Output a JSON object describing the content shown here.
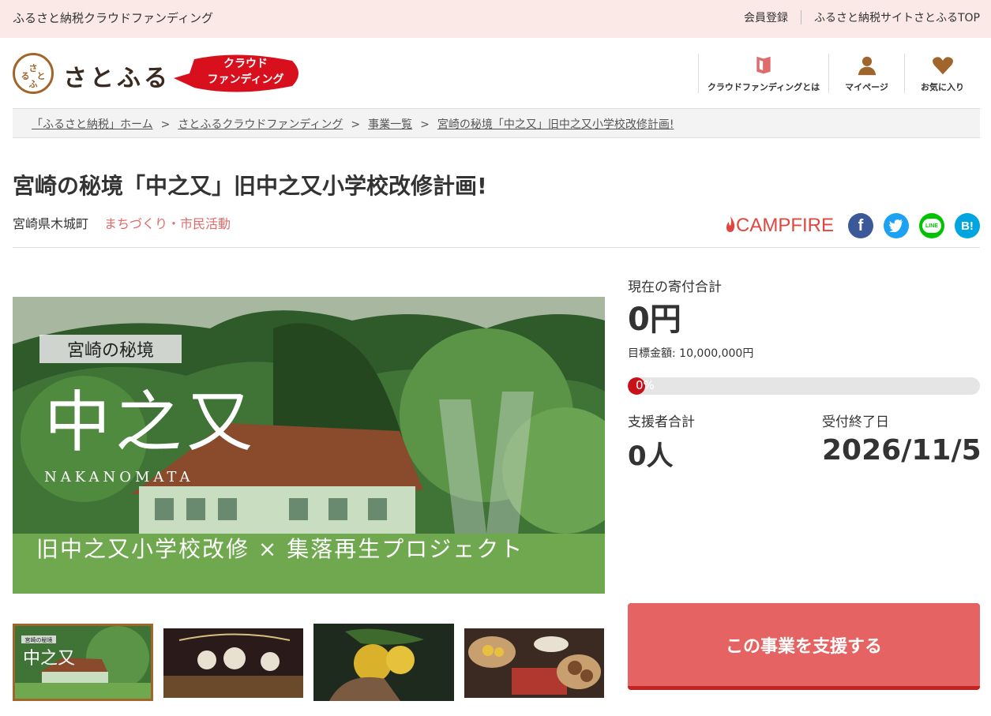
{
  "topbar": {
    "site_name": "ふるさと納税クラウドファンディング",
    "register": "会員登録",
    "main_site": "ふるさと納税サイトさとふるTOP"
  },
  "header": {
    "logo_mark": "さとふる",
    "logo_text": "さとふる",
    "badge_line1": "クラウド",
    "badge_line2": "ファンディング",
    "nav": [
      {
        "label": "クラウドファンディングとは",
        "icon": "book-icon"
      },
      {
        "label": "マイページ",
        "icon": "person-icon"
      },
      {
        "label": "お気に入り",
        "icon": "heart-icon"
      }
    ]
  },
  "breadcrumb": [
    "「ふるさと納税」ホーム",
    "さとふるクラウドファンディング",
    "事業一覧",
    "宮崎の秘境「中之又」旧中之又小学校改修計画!"
  ],
  "project": {
    "title": "宮崎の秘境「中之又」旧中之又小学校改修計画!",
    "location": "宮崎県木城町",
    "category": "まちづくり・市民活動",
    "partner": "CAMPFIRE"
  },
  "social": [
    {
      "name": "facebook",
      "glyph": "f",
      "color": "#3b5998"
    },
    {
      "name": "twitter",
      "glyph": "t",
      "color": "#1da1f2"
    },
    {
      "name": "line",
      "glyph": "LINE",
      "color": "#00c300"
    },
    {
      "name": "hatena",
      "glyph": "B!",
      "color": "#00a4de"
    }
  ],
  "image": {
    "small_caption": "宮崎の秘境",
    "big_caption": "中之又",
    "en_caption": "NAKANOMATA",
    "bottom_caption": "旧中之又小学校改修 × 集落再生プロジェクト"
  },
  "stats": {
    "total_label": "現在の寄付合計",
    "total_value": "0円",
    "goal_text": "目標金額: 10,000,000円",
    "progress_text": "0%",
    "progress_fraction": 0,
    "backers_label": "支援者合計",
    "backers_value": "0人",
    "end_label": "受付終了日",
    "end_value": "2026/11/5"
  },
  "cta": {
    "label": "この事業を支援する"
  },
  "colors": {
    "accent": "#e56363",
    "accent_dark": "#c22323",
    "brand_brown": "#a0652b",
    "topbar_bg": "#fbe9e8"
  }
}
